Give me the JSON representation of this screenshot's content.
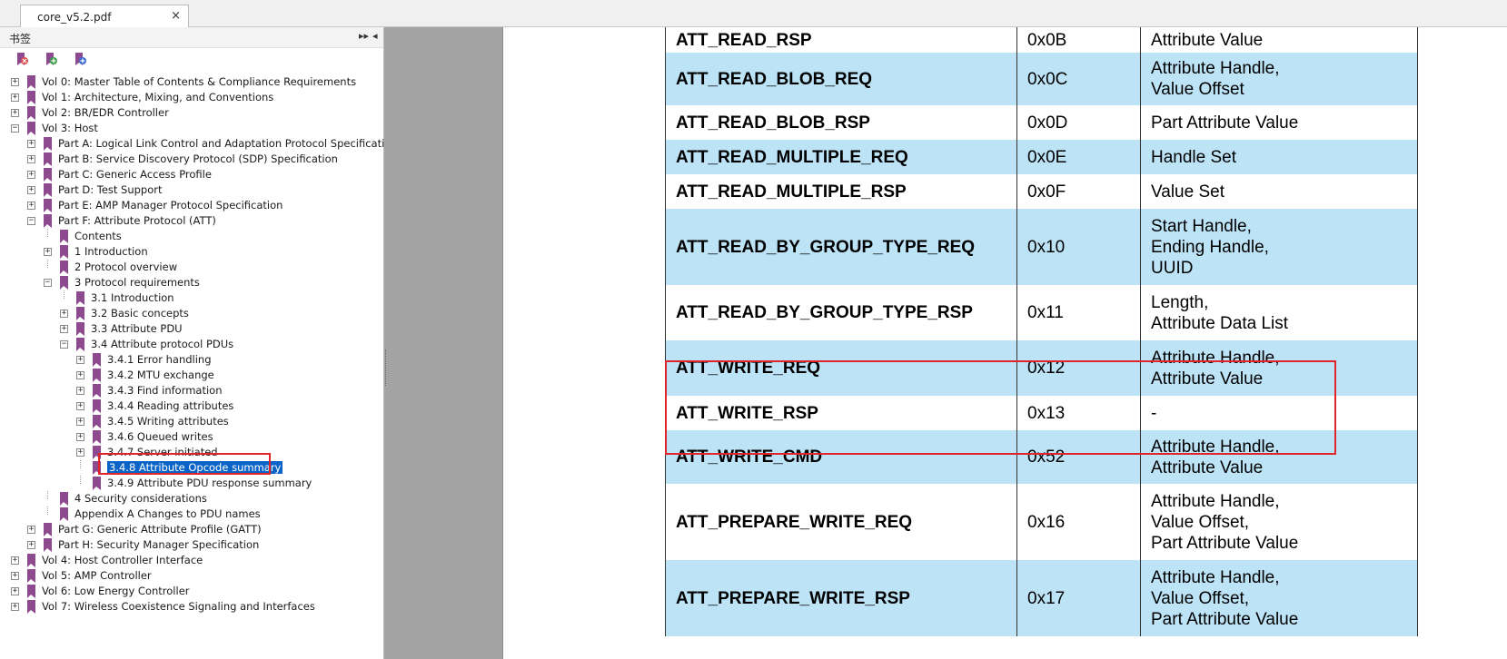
{
  "tab": {
    "title": "core_v5.2.pdf",
    "close": "×"
  },
  "bookmarks": {
    "title": "书签",
    "items": [
      {
        "label": "Vol 0: Master Table of Contents & Compliance Requirements",
        "level": 0,
        "expander": "+"
      },
      {
        "label": "Vol 1: Architecture, Mixing, and Conventions",
        "level": 0,
        "expander": "+"
      },
      {
        "label": "Vol 2: BR/EDR Controller",
        "level": 0,
        "expander": "+"
      },
      {
        "label": "Vol 3: Host",
        "level": 0,
        "expander": "-"
      },
      {
        "label": "Part A: Logical Link Control and Adaptation Protocol Specification",
        "level": 1,
        "expander": "+"
      },
      {
        "label": "Part B: Service Discovery Protocol (SDP) Specification",
        "level": 1,
        "expander": "+"
      },
      {
        "label": "Part C: Generic Access Profile",
        "level": 1,
        "expander": "+"
      },
      {
        "label": "Part D: Test Support",
        "level": 1,
        "expander": "+"
      },
      {
        "label": "Part E: AMP Manager Protocol Specification",
        "level": 1,
        "expander": "+"
      },
      {
        "label": "Part F: Attribute Protocol (ATT)",
        "level": 1,
        "expander": "-"
      },
      {
        "label": "Contents",
        "level": 2,
        "expander": ""
      },
      {
        "label": "1 Introduction",
        "level": 2,
        "expander": "+"
      },
      {
        "label": "2 Protocol overview",
        "level": 2,
        "expander": ""
      },
      {
        "label": "3 Protocol requirements",
        "level": 2,
        "expander": "-"
      },
      {
        "label": "3.1 Introduction",
        "level": 3,
        "expander": ""
      },
      {
        "label": "3.2 Basic concepts",
        "level": 3,
        "expander": "+"
      },
      {
        "label": "3.3 Attribute PDU",
        "level": 3,
        "expander": "+"
      },
      {
        "label": "3.4 Attribute protocol PDUs",
        "level": 3,
        "expander": "-"
      },
      {
        "label": "3.4.1 Error handling",
        "level": 4,
        "expander": "+"
      },
      {
        "label": "3.4.2 MTU exchange",
        "level": 4,
        "expander": "+"
      },
      {
        "label": "3.4.3 Find information",
        "level": 4,
        "expander": "+"
      },
      {
        "label": "3.4.4 Reading attributes",
        "level": 4,
        "expander": "+"
      },
      {
        "label": "3.4.5 Writing attributes",
        "level": 4,
        "expander": "+"
      },
      {
        "label": "3.4.6 Queued writes",
        "level": 4,
        "expander": "+"
      },
      {
        "label": "3.4.7 Server initiated",
        "level": 4,
        "expander": "+"
      },
      {
        "label": "3.4.8 Attribute Opcode summary",
        "level": 4,
        "expander": "",
        "selected": true
      },
      {
        "label": "3.4.9 Attribute PDU response summary",
        "level": 4,
        "expander": ""
      },
      {
        "label": "4 Security considerations",
        "level": 2,
        "expander": ""
      },
      {
        "label": "Appendix A Changes to PDU names",
        "level": 2,
        "expander": ""
      },
      {
        "label": "Part G: Generic Attribute Profile (GATT)",
        "level": 1,
        "expander": "+"
      },
      {
        "label": "Part H: Security Manager Specification",
        "level": 1,
        "expander": "+"
      },
      {
        "label": "Vol 4: Host Controller Interface",
        "level": 0,
        "expander": "+"
      },
      {
        "label": "Vol 5: AMP Controller",
        "level": 0,
        "expander": "+"
      },
      {
        "label": "Vol 6: Low Energy Controller",
        "level": 0,
        "expander": "+"
      },
      {
        "label": "Vol 7: Wireless Coexistence Signaling and Interfaces",
        "level": 0,
        "expander": "+"
      }
    ]
  },
  "table": {
    "rows": [
      {
        "name": "ATT_READ_RSP",
        "opcode": "0x0B",
        "params": [
          "Attribute Value"
        ],
        "blue": false
      },
      {
        "name": "ATT_READ_BLOB_REQ",
        "opcode": "0x0C",
        "params": [
          "Attribute Handle,",
          "Value Offset"
        ],
        "blue": true
      },
      {
        "name": "ATT_READ_BLOB_RSP",
        "opcode": "0x0D",
        "params": [
          "Part Attribute Value"
        ],
        "blue": false
      },
      {
        "name": "ATT_READ_MULTIPLE_REQ",
        "opcode": "0x0E",
        "params": [
          "Handle Set"
        ],
        "blue": true
      },
      {
        "name": "ATT_READ_MULTIPLE_RSP",
        "opcode": "0x0F",
        "params": [
          "Value Set"
        ],
        "blue": false
      },
      {
        "name": "ATT_READ_BY_GROUP_TYPE_REQ",
        "opcode": "0x10",
        "params": [
          "Start Handle,",
          "Ending Handle,",
          "UUID"
        ],
        "blue": true
      },
      {
        "name": "ATT_READ_BY_GROUP_TYPE_RSP",
        "opcode": "0x11",
        "params": [
          "Length,",
          "Attribute Data List"
        ],
        "blue": false
      },
      {
        "name": "ATT_WRITE_REQ",
        "opcode": "0x12",
        "params": [
          "Attribute Handle,",
          "Attribute Value"
        ],
        "blue": true
      },
      {
        "name": "ATT_WRITE_RSP",
        "opcode": "0x13",
        "params": [
          "-"
        ],
        "blue": false
      },
      {
        "name": "ATT_WRITE_CMD",
        "opcode": "0x52",
        "params": [
          "Attribute Handle,",
          "Attribute Value"
        ],
        "blue": true
      },
      {
        "name": "ATT_PREPARE_WRITE_REQ",
        "opcode": "0x16",
        "params": [
          "Attribute Handle,",
          "Value Offset,",
          "Part Attribute Value"
        ],
        "blue": false
      },
      {
        "name": "ATT_PREPARE_WRITE_RSP",
        "opcode": "0x17",
        "params": [
          "Attribute Handle,",
          "Value Offset,",
          "Part Attribute Value"
        ],
        "blue": true
      }
    ]
  },
  "colors": {
    "row_blue": "#bde3f7",
    "highlight_red": "#e0242a",
    "bookmark_purple": "#8e4a8e",
    "selection_blue": "#0a64c8"
  }
}
